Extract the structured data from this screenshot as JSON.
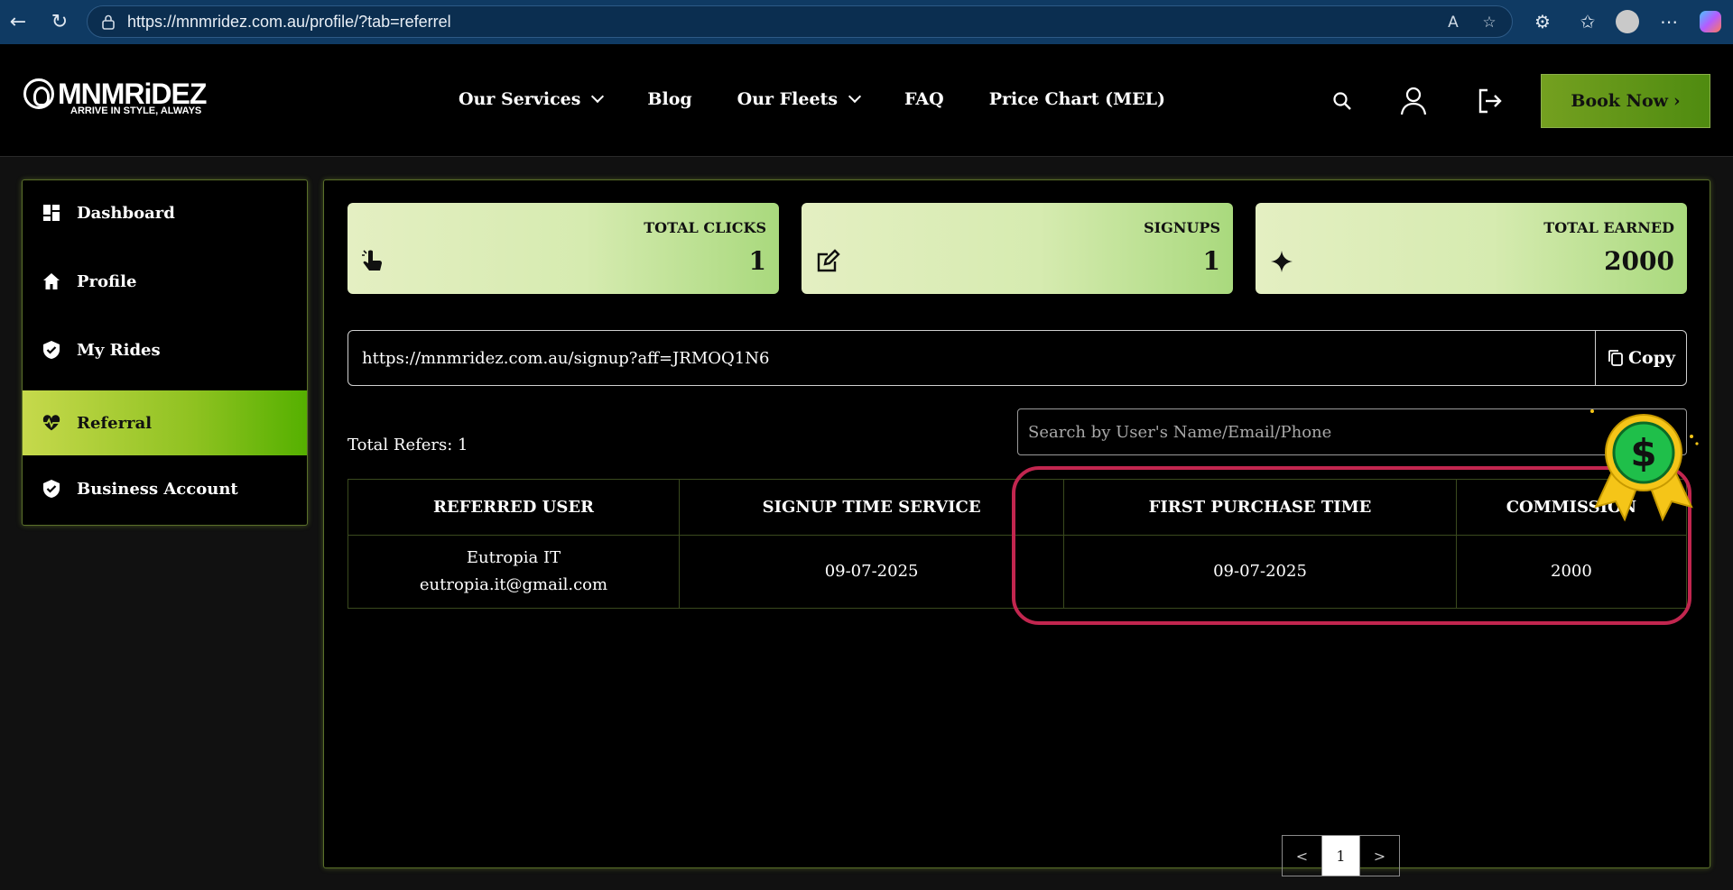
{
  "browser": {
    "url": "https://mnmridez.com.au/profile/?tab=referrel"
  },
  "header": {
    "brand": "MNMRiDEZ",
    "tagline": "ARRIVE IN STYLE, ALWAYS",
    "nav": [
      {
        "label": "Our Services"
      },
      {
        "label": "Blog"
      },
      {
        "label": "Our Fleets"
      },
      {
        "label": "FAQ"
      },
      {
        "label": "Price Chart (MEL)"
      }
    ],
    "book_label": "Book Now"
  },
  "sidebar": {
    "items": [
      {
        "label": "Dashboard",
        "icon": "dashboard-icon"
      },
      {
        "label": "Profile",
        "icon": "home-icon"
      },
      {
        "label": "My Rides",
        "icon": "shield-check-icon"
      },
      {
        "label": "Referral",
        "icon": "heartbeat-icon"
      },
      {
        "label": "Business Account",
        "icon": "shield-check-icon"
      }
    ],
    "active": "Referral"
  },
  "stats": [
    {
      "label": "TOTAL CLICKS",
      "value": "1",
      "icon": "pointer-hand-icon"
    },
    {
      "label": "SIGNUPS",
      "value": "1",
      "icon": "edit-icon"
    },
    {
      "label": "TOTAL EARNED",
      "value": "2000",
      "icon": "sparkle-icon"
    }
  ],
  "referral": {
    "link": "https://mnmridez.com.au/signup?aff=JRMOQ1N6",
    "copy_label": "Copy",
    "total_refers": "Total Refers: 1",
    "search_placeholder": "Search by User's Name/Email/Phone"
  },
  "table": {
    "headers": [
      "REFERRED USER",
      "SIGNUP TIME SERVICE",
      "FIRST PURCHASE TIME",
      "COMMISSION"
    ],
    "rows": [
      {
        "user_name": "Eutropia IT",
        "user_email": "eutropia.it@gmail.com",
        "signup_time": "09-07-2025",
        "first_purchase": "09-07-2025",
        "commission": "2000"
      }
    ]
  },
  "pagination": {
    "prev": "<",
    "current": "1",
    "next": ">"
  },
  "colors": {
    "accent_green": "#8fc221",
    "highlight": "#c2264f",
    "badge_green": "#1fbf4a",
    "badge_gold": "#f5c518"
  }
}
